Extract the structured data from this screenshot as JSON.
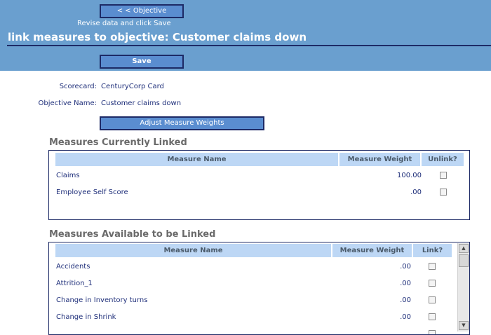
{
  "header": {
    "back_button": "< < Objective",
    "subtitle": "Revise data and click Save",
    "title": "link measures to objective:  Customer claims down",
    "save_button": "Save"
  },
  "info": {
    "scorecard_label": "Scorecard:",
    "scorecard_value": "CenturyCorp Card",
    "objective_label": "Objective Name:",
    "objective_value": "Customer claims down",
    "adjust_button": "Adjust Measure Weights"
  },
  "linked": {
    "title": "Measures Currently Linked",
    "columns": [
      "Measure Name",
      "Measure Weight",
      "Unlink?"
    ],
    "rows": [
      {
        "name": "Claims",
        "weight": "100.00",
        "checked": false
      },
      {
        "name": "Employee Self Score",
        "weight": ".00",
        "checked": false
      }
    ]
  },
  "available": {
    "title": "Measures Available to be Linked",
    "columns": [
      "Measure Name",
      "Measure Weight",
      "Link?"
    ],
    "rows": [
      {
        "name": "Accidents",
        "weight": ".00",
        "checked": false
      },
      {
        "name": "Attrition_1",
        "weight": ".00",
        "checked": false
      },
      {
        "name": "Change in Inventory turns",
        "weight": ".00",
        "checked": false
      },
      {
        "name": "Change in Shrink",
        "weight": ".00",
        "checked": false
      }
    ]
  },
  "scrollbar": {
    "up_icon": "▲",
    "down_icon": "▼"
  },
  "colors": {
    "header_bg": "#6a9fcf",
    "button_bg": "#5a8dd0",
    "table_header_bg": "#bdd7f5",
    "text": "#1f2f7a"
  }
}
